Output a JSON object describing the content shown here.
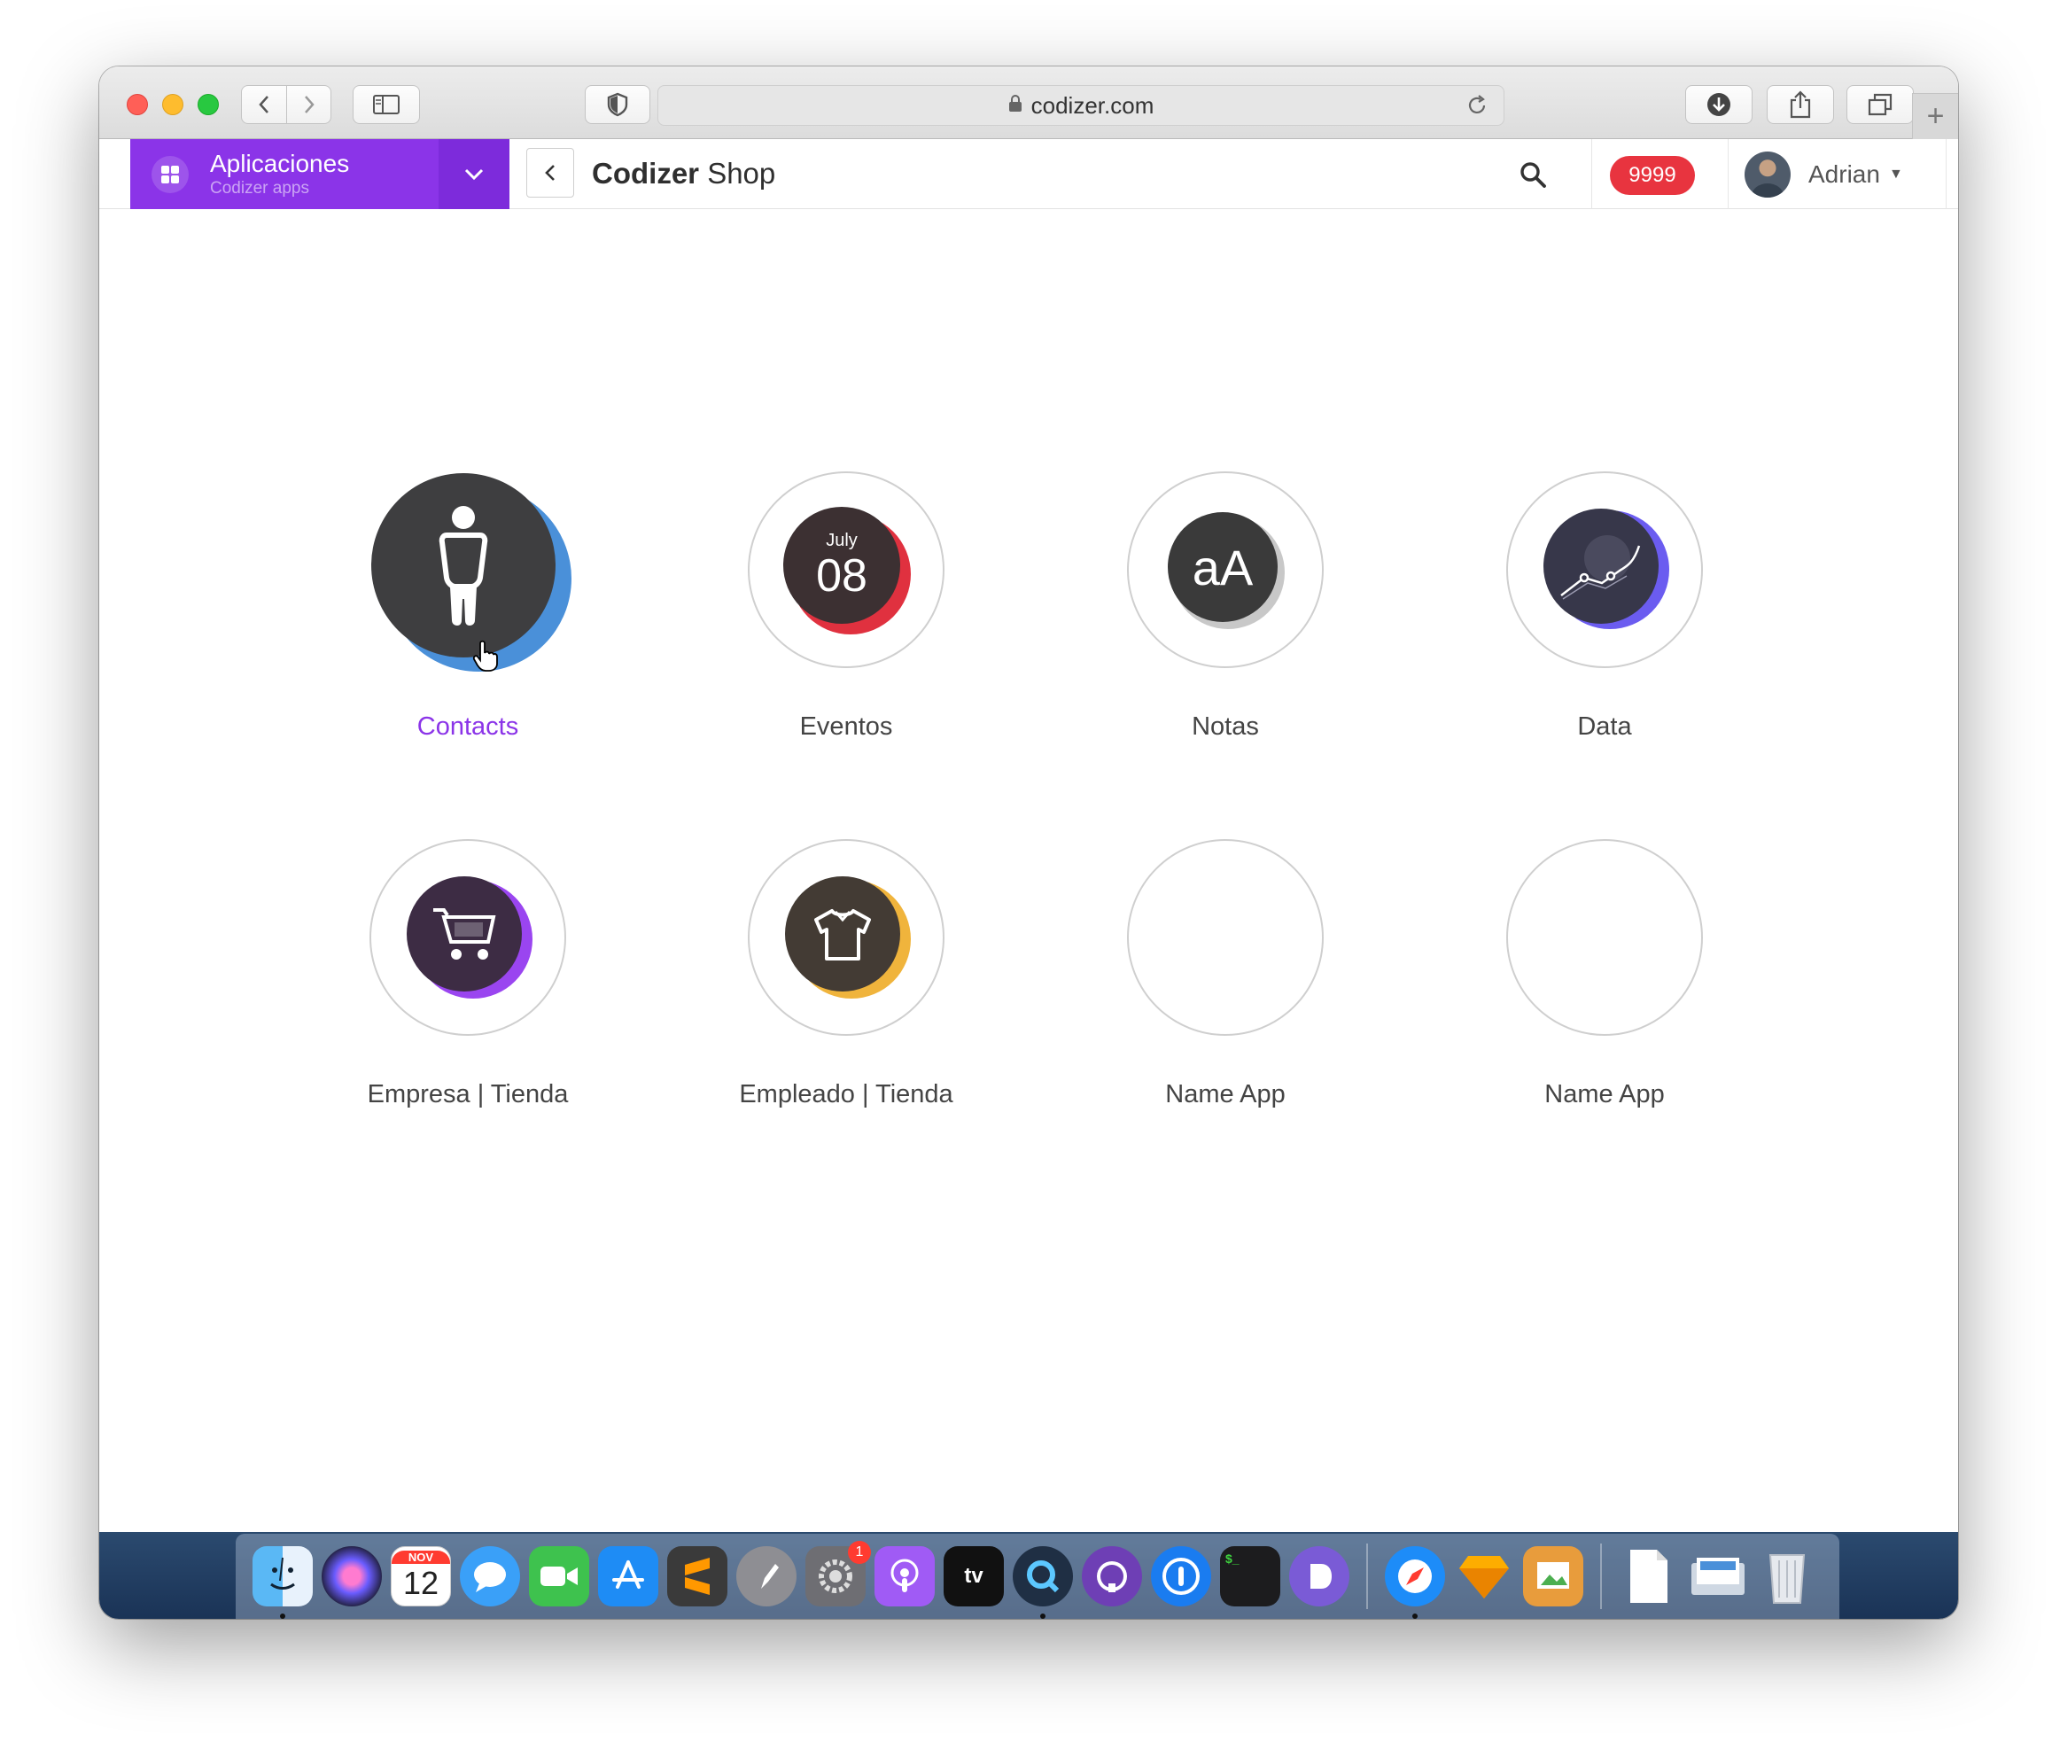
{
  "browser": {
    "url": "codizer.com",
    "new_tab_symbol": "+"
  },
  "header": {
    "apps_title": "Aplicaciones",
    "apps_subtitle": "Codizer apps",
    "title_bold": "Codizer",
    "title_regular": "Shop",
    "notification_count": "9999",
    "user_name": "Adrian"
  },
  "apps": [
    {
      "label": "Contacts",
      "icon": "person-icon",
      "accent": "#4a90d9",
      "active": true
    },
    {
      "label": "Eventos",
      "icon": "calendar-icon",
      "accent": "#e0313f",
      "month": "July",
      "day": "08"
    },
    {
      "label": "Notas",
      "icon": "notes-icon",
      "accent": "#c8c8c8",
      "text": "aA"
    },
    {
      "label": "Data",
      "icon": "chart-icon",
      "accent": "#6b5cf0"
    },
    {
      "label": "Empresa | Tienda",
      "icon": "cart-icon",
      "accent": "#9a45f0"
    },
    {
      "label": "Empleado | Tienda",
      "icon": "tshirt-icon",
      "accent": "#f0b43c"
    },
    {
      "label": "Name App",
      "icon": "empty"
    },
    {
      "label": "Name App",
      "icon": "empty"
    }
  ],
  "dock": {
    "calendar_month": "NOV",
    "calendar_day": "12",
    "settings_badge": "1",
    "tv_label": "tv"
  },
  "colors": {
    "brand_purple": "#8b34e8",
    "badge_red": "#e8343f"
  }
}
